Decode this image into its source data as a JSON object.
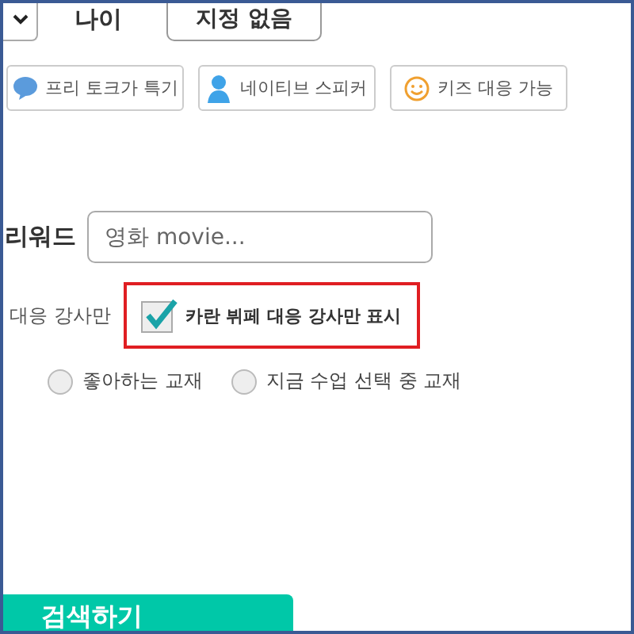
{
  "age_row": {
    "label": "나이",
    "value": "지정 없음"
  },
  "tags": [
    {
      "label": "프리 토크가 특기",
      "kind": "bubble"
    },
    {
      "label": "네이티브 스피커",
      "kind": "person"
    },
    {
      "label": "키즈 대응 가능",
      "kind": "smiley"
    }
  ],
  "keyword": {
    "label": "리워드",
    "placeholder": "영화 movie..."
  },
  "filter_row": {
    "partial_label": "대응 강사만",
    "checkbox": {
      "label": "카란 뷔페 대응 강사만 표시",
      "checked": true
    }
  },
  "material_options": [
    {
      "label": "좋아하는 교재",
      "selected": false
    },
    {
      "label": "지금 수업 선택 중 교재",
      "selected": false
    }
  ],
  "search_button": "검색하기"
}
